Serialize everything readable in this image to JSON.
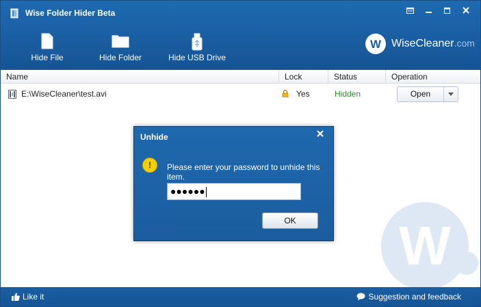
{
  "window": {
    "title": "Wise Folder Hider Beta",
    "controls": [
      "skin-icon",
      "minimize-icon",
      "maximize-icon",
      "close-icon"
    ]
  },
  "toolbar": {
    "items": [
      {
        "label": "Hide File",
        "icon": "file-icon"
      },
      {
        "label": "Hide Folder",
        "icon": "folder-icon"
      },
      {
        "label": "Hide USB Drive",
        "icon": "usb-drive-icon"
      }
    ]
  },
  "brand": {
    "name": "WiseCleaner",
    "domain": ".com",
    "logo_letter": "W"
  },
  "table": {
    "columns": [
      "Name",
      "Lock",
      "Status",
      "Operation"
    ],
    "rows": [
      {
        "name": "E:\\WiseCleaner\\test.avi",
        "lock": "Yes",
        "status": "Hidden",
        "operation": "Open"
      }
    ]
  },
  "dialog": {
    "title": "Unhide",
    "message": "Please enter your password to unhide this item.",
    "password_value": "●●●●●●",
    "ok_label": "OK"
  },
  "footer": {
    "like_label": "Like it",
    "feedback_label": "Suggestion and feedback"
  },
  "watermark_letter": "W",
  "colors": {
    "header_blue": "#1a5fa3",
    "status_green": "#2e8b2e",
    "warning_yellow": "#f5d000"
  }
}
